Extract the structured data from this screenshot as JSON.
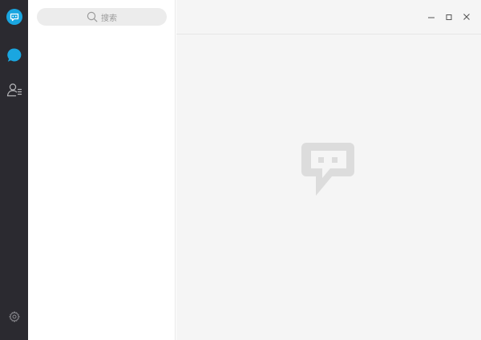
{
  "search": {
    "placeholder": "搜索"
  },
  "icons": {
    "logo": "app-logo-icon",
    "chat": "chat-bubble-icon",
    "contacts": "contacts-icon",
    "settings": "gear-icon",
    "minimize": "minimize-icon",
    "maximize": "maximize-icon",
    "close": "close-icon",
    "empty": "empty-chat-icon"
  },
  "colors": {
    "rail": "#2b2a30",
    "accent": "#1aa6e0",
    "pane": "#ffffff",
    "main": "#f5f5f5",
    "placeholder_icon": "#dcdcdc"
  }
}
